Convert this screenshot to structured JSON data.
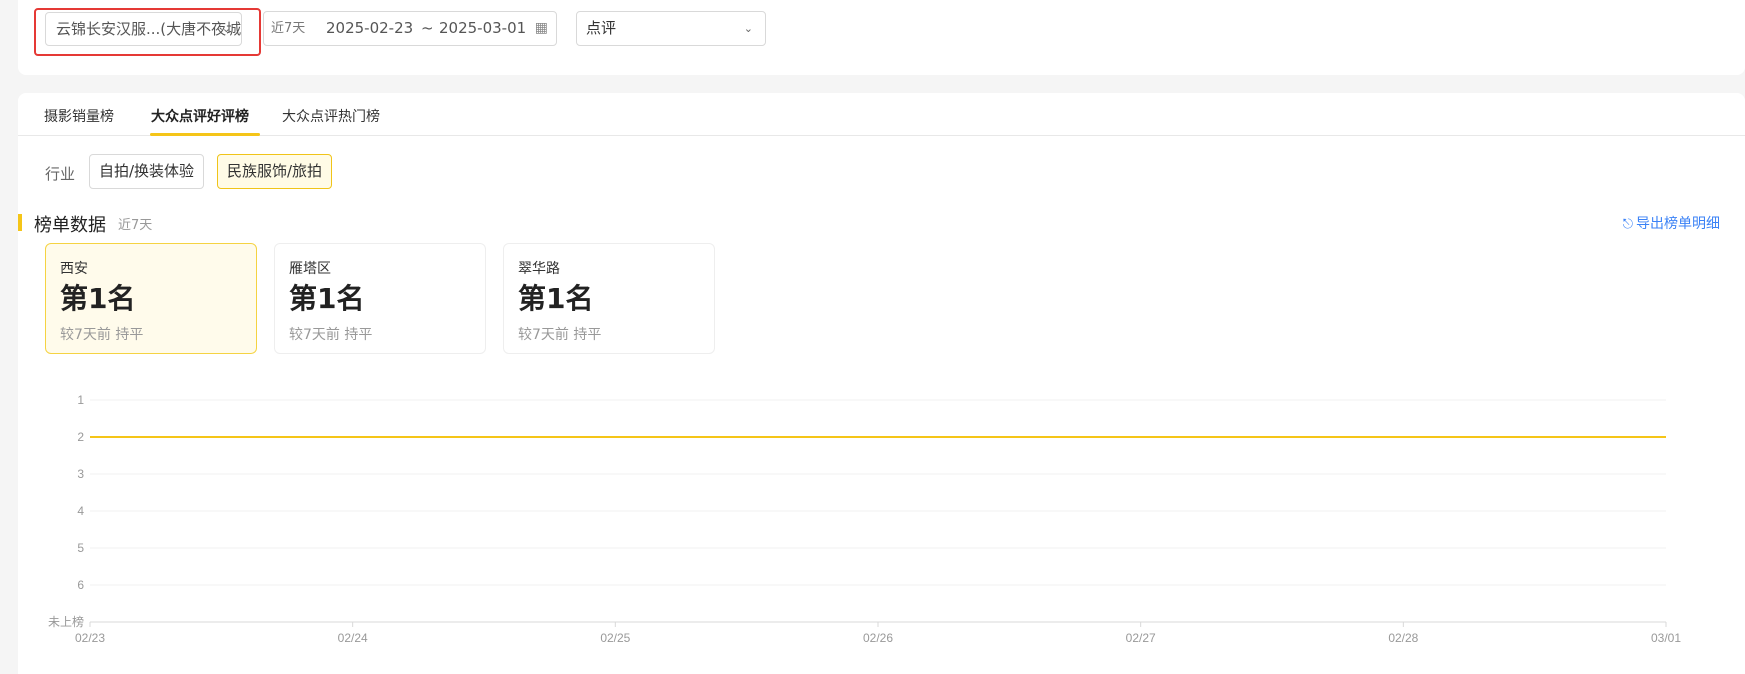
{
  "filters": {
    "store": "云锦长安汉服...(大唐不夜城店)",
    "date_preset": "近7天",
    "date_start": "2025-02-23",
    "date_separator": "~",
    "date_end": "2025-03-01",
    "platform": "点评"
  },
  "tabs": [
    {
      "label": "摄影销量榜",
      "active": false
    },
    {
      "label": "大众点评好评榜",
      "active": true
    },
    {
      "label": "大众点评热门榜",
      "active": false
    }
  ],
  "industry": {
    "label": "行业",
    "options": [
      {
        "label": "自拍/换装体验",
        "active": false
      },
      {
        "label": "民族服饰/旅拍",
        "active": true
      }
    ]
  },
  "section": {
    "title": "榜单数据",
    "subtitle": "近7天",
    "export_label": "导出榜单明细"
  },
  "rank_cards": [
    {
      "region": "西安",
      "rank": "第1名",
      "change": "较7天前  持平",
      "active": true
    },
    {
      "region": "雁塔区",
      "rank": "第1名",
      "change": "较7天前  持平",
      "active": false
    },
    {
      "region": "翠华路",
      "rank": "第1名",
      "change": "较7天前  持平",
      "active": false
    }
  ],
  "colors": {
    "accent": "#f5c518",
    "highlight": "#e53935",
    "link": "#3b82f6"
  },
  "chart_data": {
    "type": "line",
    "x": [
      "02/23",
      "02/24",
      "02/25",
      "02/26",
      "02/27",
      "02/28",
      "03/01"
    ],
    "y_ticks": [
      "1",
      "2",
      "3",
      "4",
      "5",
      "6",
      "未上榜"
    ],
    "series": [
      {
        "values": [
          2,
          2,
          2,
          2,
          2,
          2,
          2
        ],
        "color": "#f5c518"
      }
    ],
    "grid": true
  }
}
